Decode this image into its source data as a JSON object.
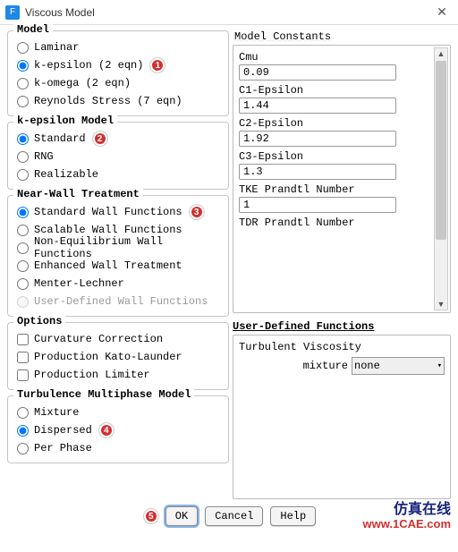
{
  "window": {
    "title": "Viscous Model",
    "icon_letter": "F"
  },
  "model": {
    "heading": "Model",
    "options": [
      {
        "label": "Laminar",
        "checked": false
      },
      {
        "label": "k-epsilon (2 eqn)",
        "checked": true,
        "badge": "1"
      },
      {
        "label": "k-omega (2 eqn)",
        "checked": false
      },
      {
        "label": "Reynolds Stress (7 eqn)",
        "checked": false
      }
    ]
  },
  "ke_model": {
    "heading": "k-epsilon Model",
    "options": [
      {
        "label": "Standard",
        "checked": true,
        "badge": "2"
      },
      {
        "label": "RNG",
        "checked": false
      },
      {
        "label": "Realizable",
        "checked": false
      }
    ]
  },
  "nwt": {
    "heading": "Near-Wall Treatment",
    "options": [
      {
        "label": "Standard Wall Functions",
        "checked": true,
        "badge": "3"
      },
      {
        "label": "Scalable Wall Functions",
        "checked": false
      },
      {
        "label": "Non-Equilibrium Wall Functions",
        "checked": false
      },
      {
        "label": "Enhanced Wall Treatment",
        "checked": false
      },
      {
        "label": "Menter-Lechner",
        "checked": false
      },
      {
        "label": "User-Defined Wall Functions",
        "checked": false,
        "disabled": true
      }
    ]
  },
  "options_grp": {
    "heading": "Options",
    "options": [
      {
        "label": "Curvature Correction",
        "checked": false
      },
      {
        "label": "Production Kato-Launder",
        "checked": false
      },
      {
        "label": "Production Limiter",
        "checked": false
      }
    ]
  },
  "tmm": {
    "heading": "Turbulence Multiphase Model",
    "options": [
      {
        "label": "Mixture",
        "checked": false
      },
      {
        "label": "Dispersed",
        "checked": true,
        "badge": "4"
      },
      {
        "label": "Per Phase",
        "checked": false
      }
    ]
  },
  "mc": {
    "heading": "Model Constants",
    "items": [
      {
        "label": "Cmu",
        "value": "0.09"
      },
      {
        "label": "C1-Epsilon",
        "value": "1.44"
      },
      {
        "label": "C2-Epsilon",
        "value": "1.92"
      },
      {
        "label": "C3-Epsilon",
        "value": "1.3"
      },
      {
        "label": "TKE Prandtl Number",
        "value": "1"
      },
      {
        "label": "TDR Prandtl Number",
        "value": ""
      }
    ]
  },
  "udf": {
    "heading": "User-Defined Functions",
    "label": "Turbulent Viscosity",
    "row_label": "mixture",
    "value": "none"
  },
  "buttons": {
    "ok": "OK",
    "cancel": "Cancel",
    "help": "Help",
    "ok_badge": "5"
  },
  "watermark": {
    "line1": "仿真在线",
    "line2": "www.1CAE.com"
  }
}
